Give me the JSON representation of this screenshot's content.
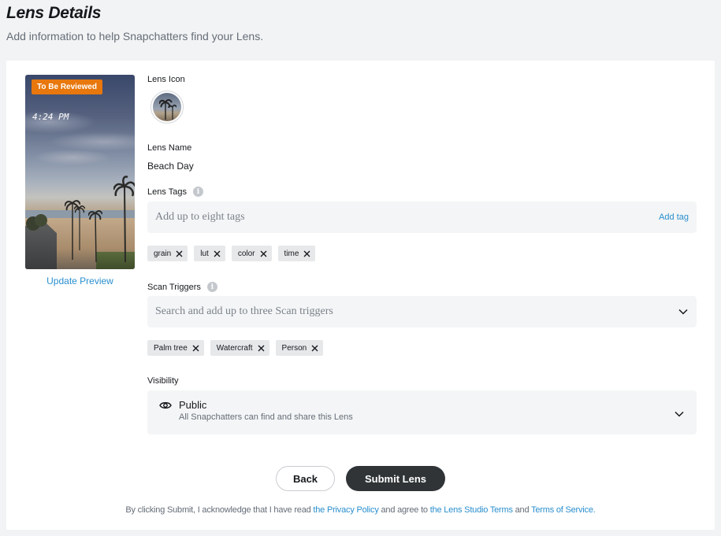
{
  "header": {
    "title": "Lens Details",
    "subtitle": "Add information to help Snapchatters find your Lens."
  },
  "preview": {
    "badge": "To Be Reviewed",
    "time": "4:24 PM",
    "update_link": "Update Preview"
  },
  "lens_icon": {
    "label": "Lens Icon"
  },
  "lens_name": {
    "label": "Lens Name",
    "value": "Beach Day"
  },
  "lens_tags": {
    "label": "Lens Tags",
    "placeholder": "Add up to eight tags",
    "add_label": "Add tag",
    "tags": [
      "grain",
      "lut",
      "color",
      "time"
    ]
  },
  "scan_triggers": {
    "label": "Scan Triggers",
    "placeholder": "Search and add up to three Scan triggers",
    "triggers": [
      "Palm tree",
      "Watercraft",
      "Person"
    ]
  },
  "visibility": {
    "label": "Visibility",
    "title": "Public",
    "description": "All Snapchatters can find and share this Lens"
  },
  "actions": {
    "back_label": "Back",
    "submit_label": "Submit Lens"
  },
  "legal": {
    "prefix": "By clicking Submit, I acknowledge that I have read ",
    "privacy_link": "the Privacy Policy",
    "middle1": " and agree to ",
    "studio_terms_link": "the Lens Studio Terms",
    "middle2": " and ",
    "tos_link": "Terms of Service."
  },
  "colors": {
    "accent": "#2a8fce",
    "badge": "#e8770d",
    "primary_button": "#303437"
  }
}
